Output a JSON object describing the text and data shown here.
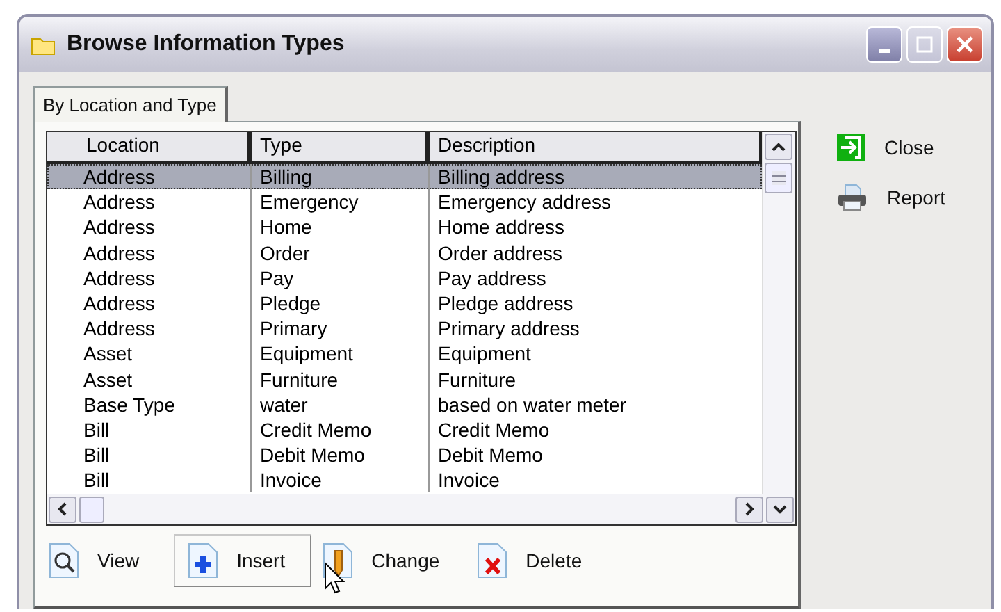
{
  "window": {
    "title": "Browse Information Types"
  },
  "tabs": [
    {
      "label": "By Location and Type",
      "selected": true
    }
  ],
  "table": {
    "columns": [
      "Location",
      "Type",
      "Description"
    ],
    "rows": [
      {
        "cells": [
          "Address",
          "Billing",
          "Billing address"
        ],
        "selected": true
      },
      {
        "cells": [
          "Address",
          "Emergency",
          "Emergency address"
        ],
        "selected": false
      },
      {
        "cells": [
          "Address",
          "Home",
          "Home address"
        ],
        "selected": false
      },
      {
        "cells": [
          "Address",
          "Order",
          "Order address"
        ],
        "selected": false
      },
      {
        "cells": [
          "Address",
          "Pay",
          "Pay address"
        ],
        "selected": false
      },
      {
        "cells": [
          "Address",
          "Pledge",
          "Pledge address"
        ],
        "selected": false
      },
      {
        "cells": [
          "Address",
          "Primary",
          "Primary address"
        ],
        "selected": false
      },
      {
        "cells": [
          "Asset",
          "Equipment",
          "Equipment"
        ],
        "selected": false
      },
      {
        "cells": [
          "Asset",
          "Furniture",
          "Furniture"
        ],
        "selected": false
      },
      {
        "cells": [
          "Base Type",
          "water",
          "based on water meter"
        ],
        "selected": false
      },
      {
        "cells": [
          "Bill",
          "Credit Memo",
          "Credit Memo"
        ],
        "selected": false
      },
      {
        "cells": [
          "Bill",
          "Debit Memo",
          "Debit Memo"
        ],
        "selected": false
      },
      {
        "cells": [
          "Bill",
          "Invoice",
          "Invoice"
        ],
        "selected": false
      }
    ]
  },
  "bottom_buttons": [
    {
      "kind": "view",
      "label": "View",
      "hot": false
    },
    {
      "kind": "insert",
      "label": "Insert",
      "hot": true
    },
    {
      "kind": "change",
      "label": "Change",
      "hot": false
    },
    {
      "kind": "delete",
      "label": "Delete",
      "hot": false
    }
  ],
  "side_buttons": [
    {
      "kind": "close",
      "label": "Close"
    },
    {
      "kind": "report",
      "label": "Report"
    }
  ]
}
